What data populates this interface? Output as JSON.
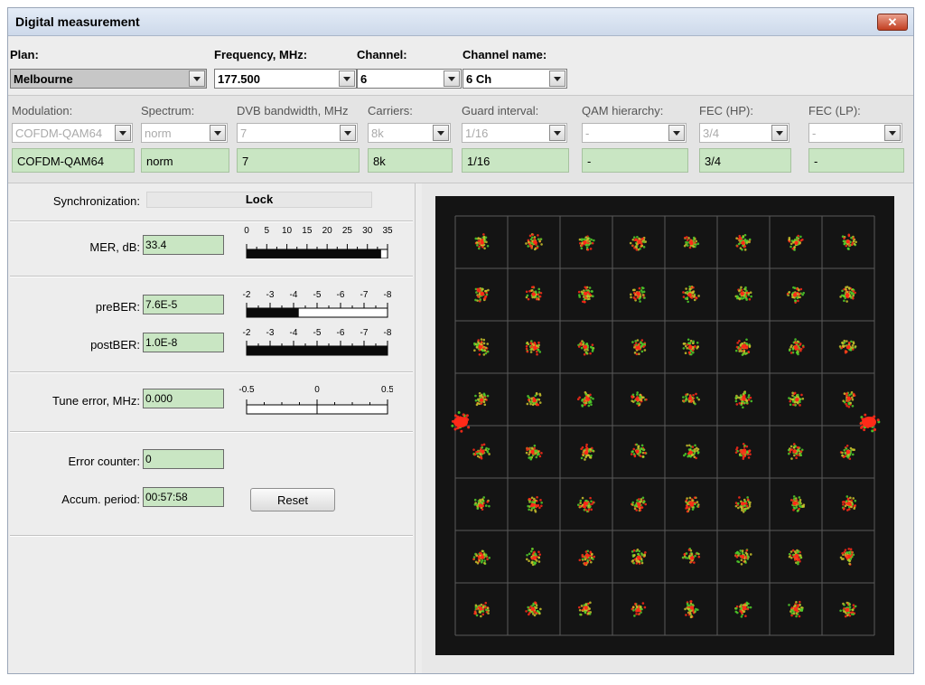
{
  "window": {
    "title": "Digital measurement",
    "close_glyph": "✕"
  },
  "top": {
    "plan": {
      "label": "Plan:",
      "value": "Melbourne"
    },
    "frequency": {
      "label": "Frequency, MHz:",
      "value": "177.500"
    },
    "channel": {
      "label": "Channel:",
      "value": "6"
    },
    "channel_name": {
      "label": "Channel name:",
      "value": "6 Ch"
    }
  },
  "params": [
    {
      "label": "Modulation:",
      "value": "COFDM-QAM64",
      "current": "COFDM-QAM64"
    },
    {
      "label": "Spectrum:",
      "value": "norm",
      "current": "norm"
    },
    {
      "label": "DVB bandwidth, MHz",
      "value": "7",
      "current": "7"
    },
    {
      "label": "Carriers:",
      "value": "8k",
      "current": "8k"
    },
    {
      "label": "Guard interval:",
      "value": "1/16",
      "current": "1/16"
    },
    {
      "label": "QAM hierarchy:",
      "value": "-",
      "current": "-"
    },
    {
      "label": "FEC (HP):",
      "value": "3/4",
      "current": "3/4"
    },
    {
      "label": "FEC (LP):",
      "value": "-",
      "current": "-"
    }
  ],
  "sync": {
    "label": "Synchronization:",
    "value": "Lock"
  },
  "mer": {
    "label": "MER, dB:",
    "value": "33.4",
    "scale": [
      "0",
      "5",
      "10",
      "15",
      "20",
      "25",
      "30",
      "35"
    ],
    "level": 33.4,
    "max": 35
  },
  "preber": {
    "label": "preBER:",
    "value": "7.6E-5",
    "scale": [
      "-2",
      "-3",
      "-4",
      "-5",
      "-6",
      "-7",
      "-8"
    ],
    "level_fraction": 0.37
  },
  "postber": {
    "label": "postBER:",
    "value": "1.0E-8",
    "scale": [
      "-2",
      "-3",
      "-4",
      "-5",
      "-6",
      "-7",
      "-8"
    ],
    "level_fraction": 1.0
  },
  "tune": {
    "label": "Tune error, MHz:",
    "value": "0.000",
    "scale": [
      "-0.5",
      "0",
      "0.5"
    ]
  },
  "error_counter": {
    "label": "Error counter:",
    "value": "0"
  },
  "accum": {
    "label": "Accum. period:",
    "value": "00:57:58"
  },
  "reset_label": "Reset",
  "constellation": {
    "order": 8,
    "colors": {
      "background": "#141414",
      "grid": "#5a5a5a",
      "green": "#4fcf2a",
      "red": "#ff2a18",
      "yellow": "#c9c22a"
    }
  }
}
